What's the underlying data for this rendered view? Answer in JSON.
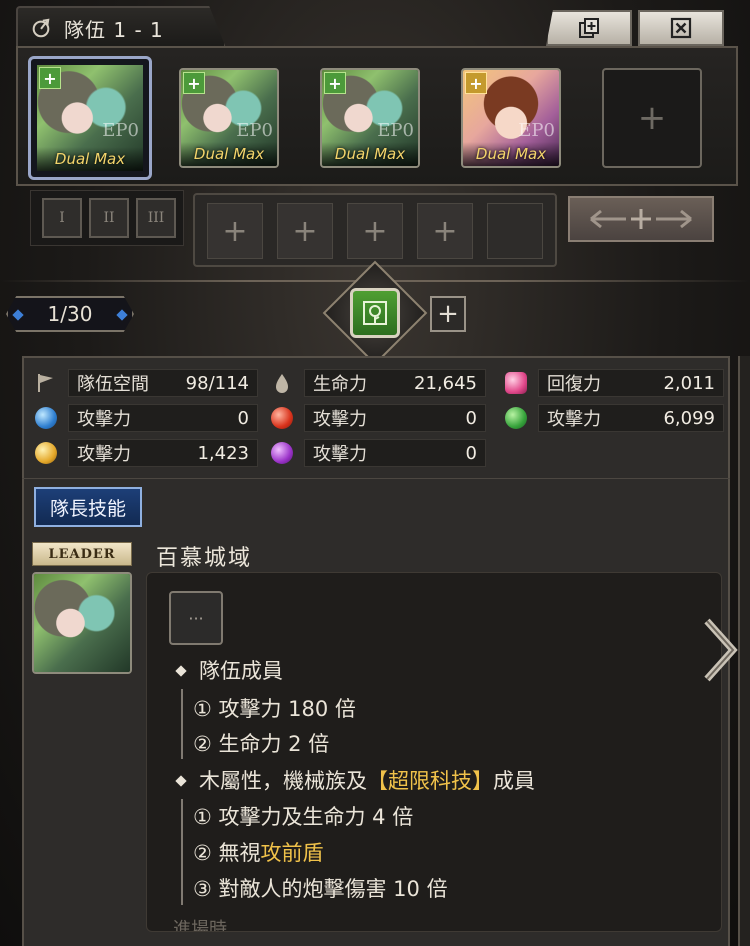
{
  "header": {
    "title": "隊伍 1 - 1",
    "icons": [
      "leaf-icon",
      "copy-icon",
      "close-icon"
    ]
  },
  "team": {
    "members": [
      {
        "label": "Dual Max",
        "ep": "EP0",
        "badge": "+",
        "theme": "green",
        "selected": true
      },
      {
        "label": "Dual Max",
        "ep": "EP0",
        "badge": "+",
        "theme": "green",
        "selected": false
      },
      {
        "label": "Dual Max",
        "ep": "EP0",
        "badge": "+",
        "theme": "green",
        "selected": false
      },
      {
        "label": "Dual Max",
        "ep": "EP0",
        "badge": "+",
        "theme": "pink",
        "selected": false
      }
    ],
    "empty_slot": "+",
    "formation_buttons": [
      "I",
      "II",
      "III"
    ],
    "sub_slots": [
      "+",
      "+",
      "+",
      "+"
    ]
  },
  "page_counter": "1/30",
  "add_team": "+",
  "stats": {
    "space_label": "隊伍空間",
    "space_value": "98/114",
    "hp_label": "生命力",
    "hp_value": "21,645",
    "recovery_label": "回復力",
    "recovery_value": "2,011",
    "water_atk_label": "攻擊力",
    "water_atk_value": "0",
    "fire_atk_label": "攻擊力",
    "fire_atk_value": "0",
    "earth_atk_label": "攻擊力",
    "earth_atk_value": "6,099",
    "light_atk_label": "攻擊力",
    "light_atk_value": "1,423",
    "dark_atk_label": "攻擊力",
    "dark_atk_value": "0"
  },
  "leader_skill": {
    "button_label": "隊長技能",
    "tag": "LEADER",
    "name": "百慕城域",
    "icon_text": "···",
    "section1_title": "隊伍成員",
    "section1_item1": "① 攻擊力 180 倍",
    "section1_item2": "② 生命力 2 倍",
    "section2_prefix": "木屬性，機械族及",
    "section2_highlight": "【超限科技】",
    "section2_suffix": "成員",
    "section2_item1": "① 攻擊力及生命力 4 倍",
    "section2_item2_prefix": "② 無視",
    "section2_item2_highlight": "攻前盾",
    "section2_item3": "③ 對敵人的炮擊傷害 10 倍",
    "fade_text": "進場時"
  },
  "colors": {
    "accent_gold": "#f0c24a",
    "skill_button_blue": "#1d3f78",
    "selected_border": "#9aa6c8"
  }
}
